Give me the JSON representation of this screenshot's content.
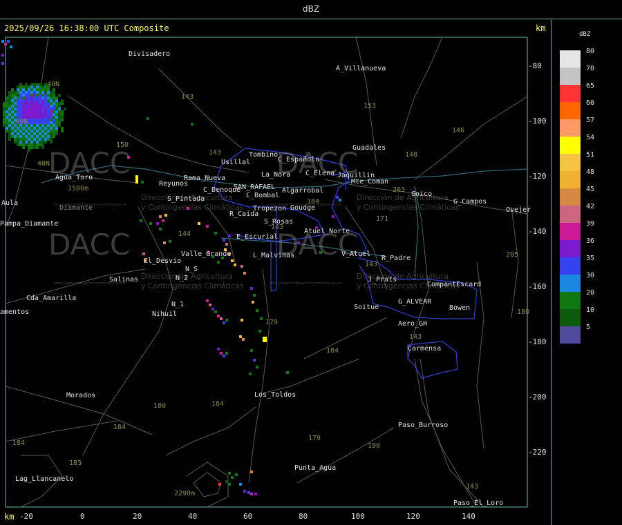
{
  "title": "dBZ",
  "timestamp": "2025/09/26 16:38:00 UTC Composite",
  "axes": {
    "unit_top": "km",
    "unit_bottom": "km",
    "y_ticks": [
      "-80",
      "-100",
      "-120",
      "-140",
      "-160",
      "-180",
      "-200",
      "-220"
    ],
    "x_ticks": [
      "-20",
      "0",
      "20",
      "40",
      "60",
      "80",
      "100",
      "120",
      "140"
    ]
  },
  "legend": {
    "title": "dBZ",
    "entries": [
      {
        "label": "80",
        "color": "#e6e6e6"
      },
      {
        "label": "70",
        "color": "#c3c3c3"
      },
      {
        "label": "65",
        "color": "#ff3333"
      },
      {
        "label": "60",
        "color": "#ff6600"
      },
      {
        "label": "57",
        "color": "#ff9966"
      },
      {
        "label": "54",
        "color": "#ffff00"
      },
      {
        "label": "51",
        "color": "#f5c242"
      },
      {
        "label": "48",
        "color": "#f0b030"
      },
      {
        "label": "45",
        "color": "#d6893f"
      },
      {
        "label": "42",
        "color": "#cc6680"
      },
      {
        "label": "39",
        "color": "#cc1a99"
      },
      {
        "label": "36",
        "color": "#7a1acc"
      },
      {
        "label": "35",
        "color": "#3344ee"
      },
      {
        "label": "30",
        "color": "#1a88e0"
      },
      {
        "label": "20",
        "color": "#117711"
      },
      {
        "label": "10",
        "color": "#0b5a0b"
      },
      {
        "label": "5",
        "color": "#4f4a9e"
      }
    ]
  },
  "places": [
    "Divisadero",
    "A_Villanueva",
    "Guadales",
    "Tombino",
    "Usillal",
    "C_Española",
    "La_Nora",
    "C_Elena",
    "Jaquillin",
    "Mte_Coman",
    "Goico",
    "G_Campos",
    "Ovejer",
    "Agua_Toro",
    "Reyunos",
    "Rama_Nueva",
    "C_Benoque",
    "SAN_RAFAEL",
    "C_Bombal",
    "Algarrobal",
    "S_Pintada",
    "Tropezon",
    "Goudge",
    "Aula",
    "Pampa_Diamante",
    "R_Caida",
    "S_Rosas",
    "Atuel_Norte",
    "E_Escurial",
    "Valle_Grande",
    "L_Malvinas",
    "V_Atuel",
    "R_Padre",
    "El_Desvio",
    "N_S",
    "N_2",
    "Salinas",
    "J_Prats",
    "CompantEscard",
    "Cda_Amarilla",
    "N_1",
    "Nihuil",
    "G_ALVEAR",
    "Bowen",
    "amentos",
    "Soitue",
    "Aero_GH",
    "Carmensa",
    "Morados",
    "Los_Toldos",
    "Paso_Burroso",
    "Lag_Llancanelo",
    "Punta_Agua",
    "Paso_El_Loro",
    "2290m",
    "1500m",
    "Diamante"
  ],
  "routes": [
    "143",
    "153",
    "146",
    "148",
    "150",
    "143",
    "203",
    "171",
    "40N",
    "40N",
    "40N",
    "144",
    "143",
    "143",
    "205",
    "184",
    "179",
    "184",
    "180",
    "184",
    "179",
    "190",
    "183",
    "184",
    "143",
    "143",
    "184",
    "180",
    "184",
    "183"
  ],
  "watermark": {
    "brand": "DACC",
    "line1": "Dirección de Agricultura",
    "line2": "y Contingencias Climáticas",
    "url": "http://www.contingencias.mendoza.gov.ar"
  }
}
